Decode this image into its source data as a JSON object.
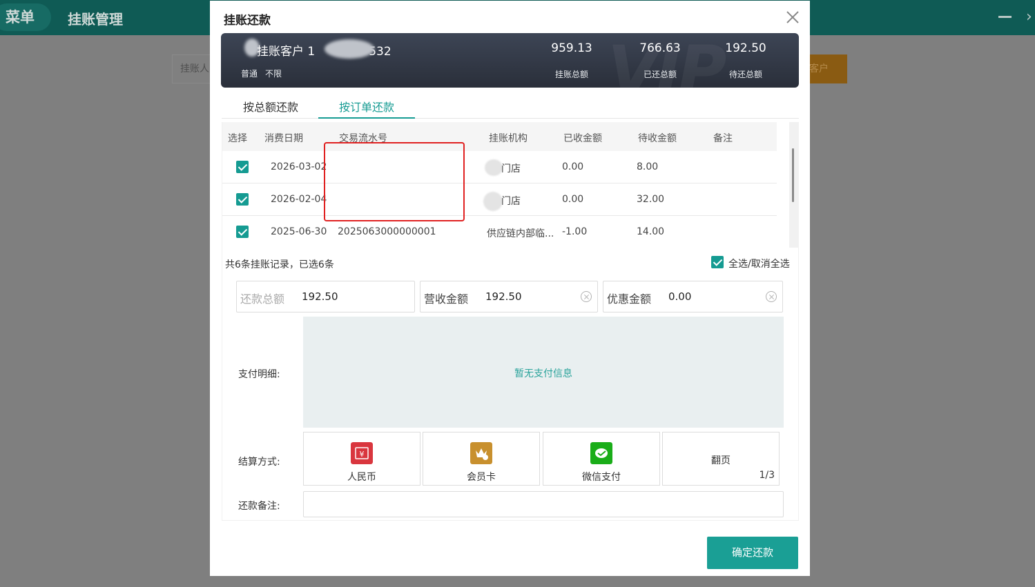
{
  "app": {
    "menu_label": "菜单",
    "page_title": "挂账管理",
    "bg_input_placeholder": "挂账人",
    "bg_button_label": "客户"
  },
  "modal": {
    "title": "挂账还款",
    "customer": {
      "name": "挂账客户 1",
      "name_suffix": "532",
      "level": "普通",
      "limit": "不限",
      "watermark": "VIP"
    },
    "stats": [
      {
        "value": "959.13",
        "label": "挂账总额"
      },
      {
        "value": "766.63",
        "label": "已还总额"
      },
      {
        "value": "192.50",
        "label": "待还总额"
      }
    ],
    "tabs": [
      {
        "label": "按总额还款",
        "active": false
      },
      {
        "label": "按订单还款",
        "active": true
      }
    ],
    "table": {
      "headers": [
        "选择",
        "消费日期",
        "交易流水号",
        "挂账机构",
        "已收金额",
        "待收金额",
        "备注"
      ],
      "rows": [
        {
          "checked": true,
          "date": "2026-03-02",
          "serial": "",
          "org": "门店",
          "received": "0.00",
          "pending": "8.00",
          "note": ""
        },
        {
          "checked": true,
          "date": "2026-02-04",
          "serial": "",
          "org": "门店",
          "received": "0.00",
          "pending": "32.00",
          "note": ""
        },
        {
          "checked": true,
          "date": "2025-06-30",
          "serial": "2025063000000001",
          "org": "供应链内部临...",
          "received": "-1.00",
          "pending": "14.00",
          "note": ""
        }
      ]
    },
    "summary_text": "共6条挂账记录，已选6条",
    "select_all_label": "全选/取消全选",
    "amounts": {
      "total_label": "还款总额",
      "total_value": "192.50",
      "revenue_label": "营收金额",
      "revenue_value": "192.50",
      "discount_label": "优惠金额",
      "discount_value": "0.00"
    },
    "payment_detail_label": "支付明细:",
    "payment_detail_empty": "暂无支付信息",
    "settle_label": "结算方式:",
    "pay_methods": [
      {
        "label": "人民币",
        "icon": "rmb-icon",
        "color": "#d9363e"
      },
      {
        "label": "会员卡",
        "icon": "member-card-icon",
        "color": "#c8902e"
      },
      {
        "label": "微信支付",
        "icon": "wechat-pay-icon",
        "color": "#1aad19"
      }
    ],
    "paging": {
      "label": "翻页",
      "page": "1/3"
    },
    "remark_label": "还款备注:",
    "confirm_label": "确定还款"
  },
  "colors": {
    "accent": "#159b92",
    "header_bg": "#0f5b55",
    "highlight_box": "#e02020"
  }
}
